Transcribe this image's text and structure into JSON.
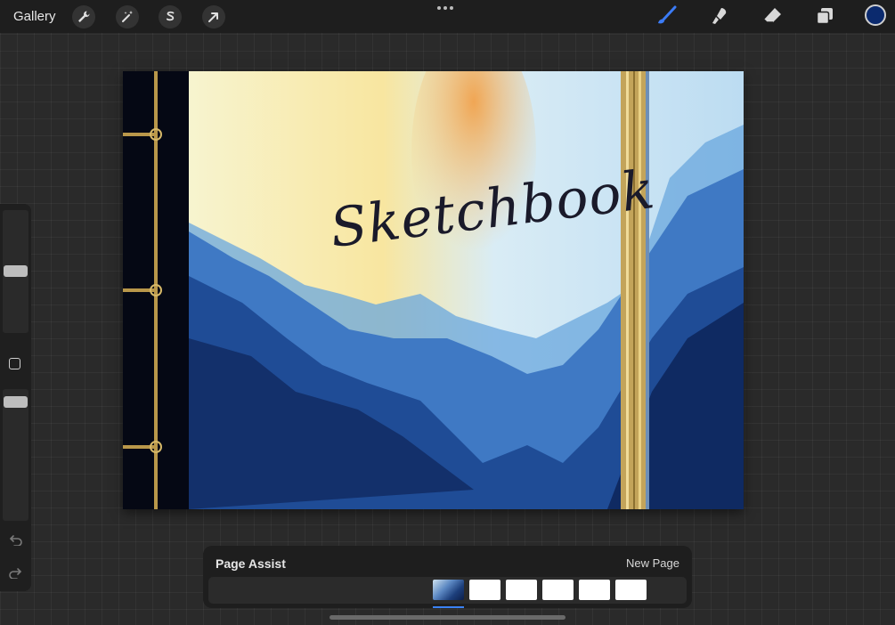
{
  "toolbar": {
    "gallery_label": "Gallery",
    "left_tools": [
      "wrench-icon",
      "magic-wand-icon",
      "selection-s-icon",
      "transform-arrow-icon"
    ],
    "right_tools": [
      "brush-icon",
      "smudge-icon",
      "eraser-icon",
      "layers-icon"
    ],
    "active_tool": "brush-icon",
    "active_tool_color": "#3b7bf6",
    "current_color": "#0b2a6e"
  },
  "sidebar": {
    "brush_size": 0.5,
    "opacity": 0.9
  },
  "canvas": {
    "title": "Sketchbook"
  },
  "page_assist": {
    "title": "Page Assist",
    "new_page_label": "New Page",
    "page_count": 6,
    "active_page": 1
  },
  "colors": {
    "accent": "#3b82f6",
    "panel_bg": "#1e1e1e"
  }
}
